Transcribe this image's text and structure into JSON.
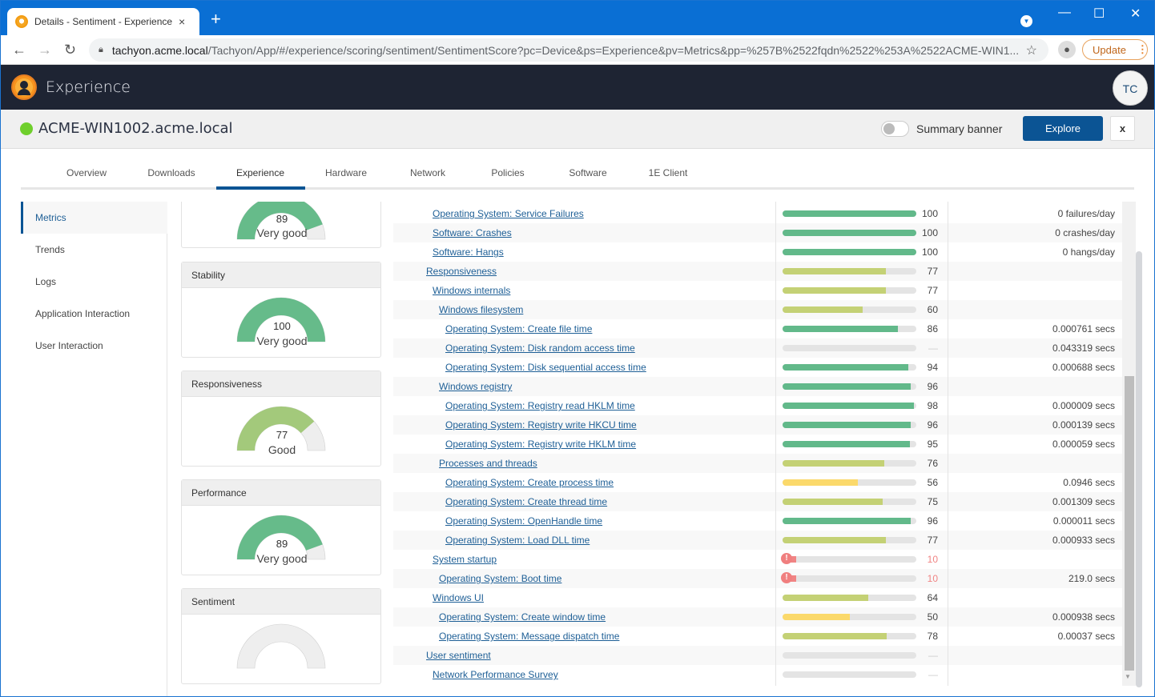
{
  "browser": {
    "tab_title": "Details - Sentiment - Experience",
    "tab_close": "×",
    "new_tab": "+",
    "window_controls": {
      "minimize": "—",
      "maximize": "☐",
      "close": "✕"
    },
    "url_host": "tachyon.acme.local",
    "url_path": "/Tachyon/App/#/experience/scoring/sentiment/SentimentScore?pc=Device&ps=Experience&pv=Metrics&pp=%257B%2522fqdn%2522%253A%2522ACME-WIN1...",
    "update_label": "Update"
  },
  "app": {
    "title": "Experience",
    "avatar_initials": "TC"
  },
  "device": {
    "name": "ACME-WIN1002.acme.local",
    "status_color": "#6fcf2c",
    "summary_banner_label": "Summary banner",
    "summary_banner_on": false,
    "explore_label": "Explore",
    "close_label": "x"
  },
  "tabs": [
    {
      "label": "Overview"
    },
    {
      "label": "Downloads"
    },
    {
      "label": "Experience",
      "active": true
    },
    {
      "label": "Hardware"
    },
    {
      "label": "Network"
    },
    {
      "label": "Policies"
    },
    {
      "label": "Software"
    },
    {
      "label": "1E Client"
    }
  ],
  "left_nav": [
    {
      "label": "Metrics",
      "active": true
    },
    {
      "label": "Trends"
    },
    {
      "label": "Logs"
    },
    {
      "label": "Application Interaction"
    },
    {
      "label": "User Interaction"
    }
  ],
  "score_cards": [
    {
      "title": "",
      "score": 89,
      "label": "Very good",
      "color": "#66bb8a"
    },
    {
      "title": "Stability",
      "score": 100,
      "label": "Very good",
      "color": "#66bb8a"
    },
    {
      "title": "Responsiveness",
      "score": 77,
      "label": "Good",
      "color": "#a3c97b"
    },
    {
      "title": "Performance",
      "score": 89,
      "label": "Very good",
      "color": "#66bb8a"
    },
    {
      "title": "Sentiment",
      "score": null,
      "label": "",
      "color": "#eeeeee"
    }
  ],
  "colors": {
    "very_good": "#62b98a",
    "good": "#c4d175",
    "fair": "#fbd96b",
    "poor": "#f08484",
    "empty": "#e4e4e4",
    "link": "#1e5f96",
    "brand": "#0b5494"
  },
  "metrics": [
    {
      "name": "Operating System: Service Failures",
      "level": 2,
      "score": 100,
      "raw": "0 failures/day"
    },
    {
      "name": "Software: Crashes",
      "level": 2,
      "score": 100,
      "raw": "0 crashes/day"
    },
    {
      "name": "Software: Hangs",
      "level": 2,
      "score": 100,
      "raw": "0 hangs/day"
    },
    {
      "name": "Responsiveness",
      "level": 1,
      "score": 77,
      "raw": ""
    },
    {
      "name": "Windows internals",
      "level": 2,
      "score": 77,
      "raw": ""
    },
    {
      "name": "Windows filesystem",
      "level": 3,
      "score": 60,
      "raw": ""
    },
    {
      "name": "Operating System: Create file time",
      "level": 4,
      "score": 86,
      "raw": "0.000761 secs"
    },
    {
      "name": "Operating System: Disk random access time",
      "level": 4,
      "score": null,
      "score_text": "—",
      "raw": "0.043319 secs"
    },
    {
      "name": "Operating System: Disk sequential access time",
      "level": 4,
      "score": 94,
      "raw": "0.000688 secs"
    },
    {
      "name": "Windows registry",
      "level": 3,
      "score": 96,
      "raw": ""
    },
    {
      "name": "Operating System: Registry read HKLM time",
      "level": 4,
      "score": 98,
      "raw": "0.000009 secs"
    },
    {
      "name": "Operating System: Registry write HKCU time",
      "level": 4,
      "score": 96,
      "raw": "0.000139 secs"
    },
    {
      "name": "Operating System: Registry write HKLM time",
      "level": 4,
      "score": 95,
      "raw": "0.000059 secs"
    },
    {
      "name": "Processes and threads",
      "level": 3,
      "score": 76,
      "raw": ""
    },
    {
      "name": "Operating System: Create process time",
      "level": 4,
      "score": 56,
      "raw": "0.0946 secs"
    },
    {
      "name": "Operating System: Create thread time",
      "level": 4,
      "score": 75,
      "raw": "0.001309 secs"
    },
    {
      "name": "Operating System: OpenHandle time",
      "level": 4,
      "score": 96,
      "raw": "0.000011 secs"
    },
    {
      "name": "Operating System: Load DLL time",
      "level": 4,
      "score": 77,
      "raw": "0.000933 secs"
    },
    {
      "name": "System startup",
      "level": 2,
      "score": 10,
      "raw": "",
      "warning": true
    },
    {
      "name": "Operating System: Boot time",
      "level": 3,
      "score": 10,
      "raw": "219.0 secs",
      "warning": true
    },
    {
      "name": "Windows UI",
      "level": 2,
      "score": 64,
      "raw": ""
    },
    {
      "name": "Operating System: Create window time",
      "level": 3,
      "score": 50,
      "raw": "0.000938 secs"
    },
    {
      "name": "Operating System: Message dispatch time",
      "level": 3,
      "score": 78,
      "raw": "0.00037 secs"
    },
    {
      "name": "User sentiment",
      "level": 1,
      "score": null,
      "score_text": "—",
      "raw": ""
    },
    {
      "name": "Network Performance Survey",
      "level": 2,
      "score": null,
      "score_text": "—",
      "raw": ""
    }
  ]
}
